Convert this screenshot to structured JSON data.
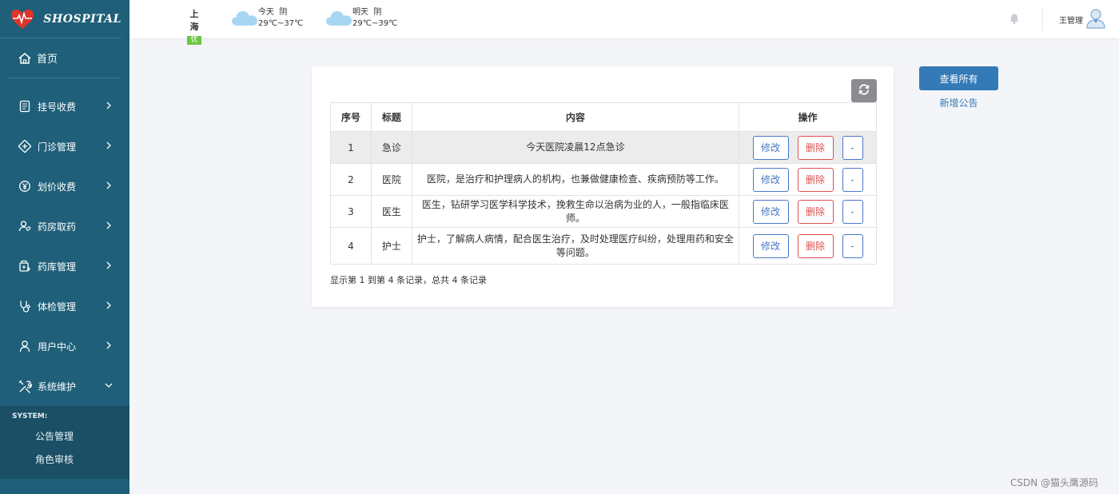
{
  "brand": {
    "name": "SHOSPITAL"
  },
  "sidebar": {
    "home_label": "首页",
    "items": [
      {
        "label": "挂号收费",
        "icon": "document-icon"
      },
      {
        "label": "门诊管理",
        "icon": "medical-cross-icon"
      },
      {
        "label": "划价收费",
        "icon": "yen-icon"
      },
      {
        "label": "药房取药",
        "icon": "user-pill-icon"
      },
      {
        "label": "药库管理",
        "icon": "medicine-box-icon"
      },
      {
        "label": "体检管理",
        "icon": "stethoscope-icon"
      },
      {
        "label": "用户中心",
        "icon": "user-icon"
      },
      {
        "label": "系统维护",
        "icon": "tools-icon"
      }
    ],
    "submenu_title": "SYSTEM:",
    "submenu_items": [
      "公告管理",
      "角色审核"
    ]
  },
  "topbar": {
    "city": "上海",
    "aqi": "优",
    "today": {
      "day": "今天",
      "condition": "阴",
      "temp": "29℃~37℃"
    },
    "tomorrow": {
      "day": "明天",
      "condition": "阴",
      "temp": "29℃~39℃"
    },
    "username": "王管理"
  },
  "table": {
    "headers": {
      "index": "序号",
      "title": "标题",
      "content": "内容",
      "ops": "操作"
    },
    "rows": [
      {
        "index": "1",
        "title": "急诊",
        "content": "今天医院凌晨12点急诊"
      },
      {
        "index": "2",
        "title": "医院",
        "content": "医院，是治疗和护理病人的机构，也兼做健康检查、疾病预防等工作。"
      },
      {
        "index": "3",
        "title": "医生",
        "content": "医生，钻研学习医学科学技术，挽救生命以治病为业的人，一般指临床医师。"
      },
      {
        "index": "4",
        "title": "护士",
        "content": "护士，了解病人病情，配合医生治疗，及时处理医疗纠纷，处理用药和安全等问题。"
      }
    ],
    "edit_label": "修改",
    "delete_label": "删除",
    "more_label": "-",
    "summary": "显示第 1 到第 4 条记录，总共 4 条记录"
  },
  "actions": {
    "view_all": "查看所有",
    "add_notice": "新增公告"
  },
  "watermark": "CSDN @猫头鹰源码",
  "colors": {
    "sidebar": "#1f5f79",
    "primary": "#337ab7",
    "danger": "#d9534f"
  }
}
